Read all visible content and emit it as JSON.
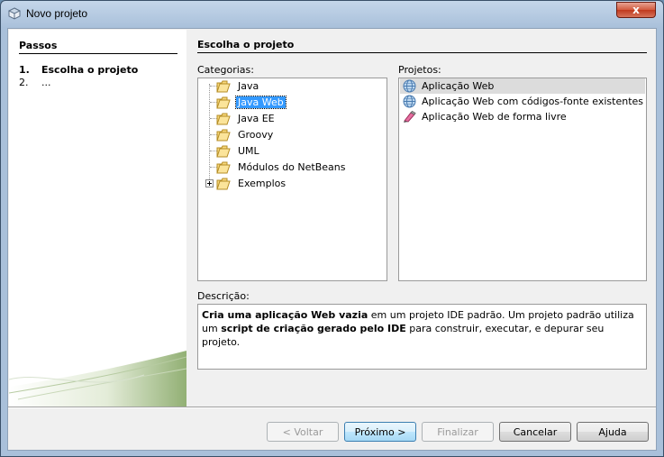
{
  "window": {
    "title": "Novo projeto",
    "close_glyph": "x"
  },
  "steps": {
    "title": "Passos",
    "items": [
      {
        "num": "1.",
        "label": "Escolha o projeto"
      },
      {
        "num": "2.",
        "label": "..."
      }
    ]
  },
  "main": {
    "title": "Escolha o projeto",
    "categories_label": "Categorias:",
    "projects_label": "Projetos:",
    "description_label": "Descrição:",
    "categories": [
      "Java",
      "Java Web",
      "Java EE",
      "Groovy",
      "UML",
      "Módulos do NetBeans",
      "Exemplos"
    ],
    "selected_category": "Java Web",
    "projects": [
      "Aplicação Web",
      "Aplicação Web com códigos-fonte existentes",
      "Aplicação Web de forma livre"
    ],
    "selected_project": "Aplicação Web",
    "description": {
      "part1_bold": "Cria uma aplicação Web vazia",
      "part2": " em um projeto IDE padrão. Um projeto padrão utiliza um ",
      "part3_bold": "script de criação gerado pelo IDE",
      "part4": " para construir, executar, e depurar seu projeto."
    }
  },
  "buttons": {
    "back": "< Voltar",
    "next": "Próximo >",
    "finish": "Finalizar",
    "cancel": "Cancelar",
    "help": "Ajuda"
  },
  "icons": {
    "window": "netbeans-cube-icon",
    "folder": "folder-icon",
    "web_project": "globe-icon",
    "freeform_project": "freeform-web-icon"
  }
}
